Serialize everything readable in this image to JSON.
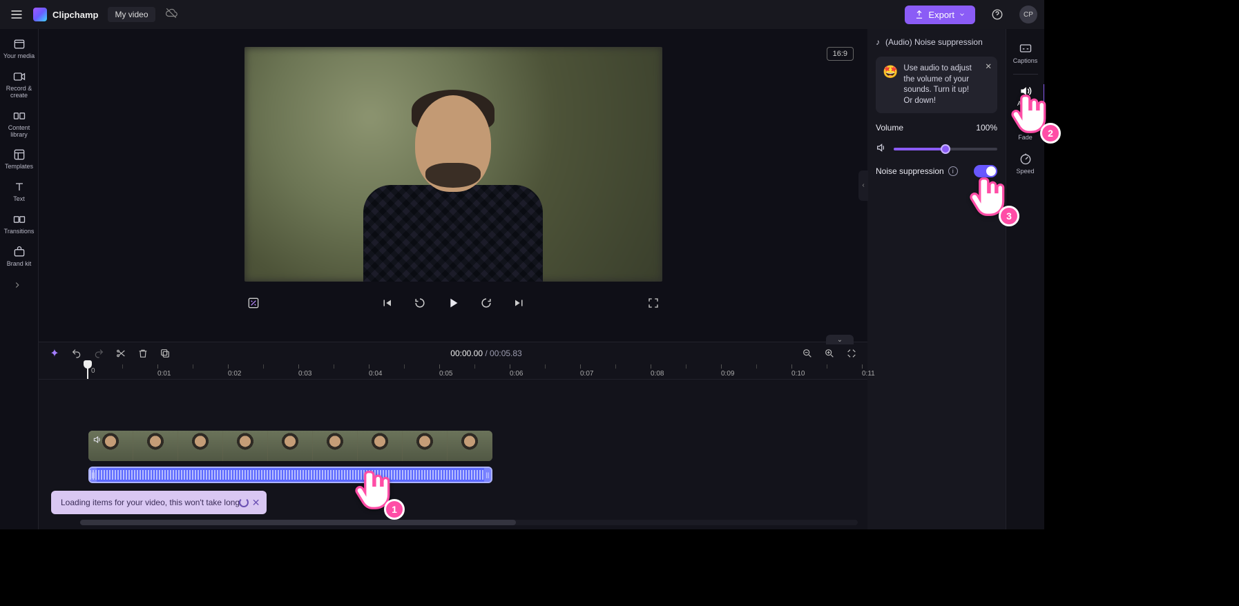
{
  "header": {
    "brand": "Clipchamp",
    "project_title": "My video",
    "export_label": "Export",
    "avatar_initials": "CP",
    "aspect_ratio": "16:9"
  },
  "left_sidebar": {
    "items": [
      {
        "label": "Your media"
      },
      {
        "label": "Record & create"
      },
      {
        "label": "Content library"
      },
      {
        "label": "Templates"
      },
      {
        "label": "Text"
      },
      {
        "label": "Transitions"
      },
      {
        "label": "Brand kit"
      }
    ]
  },
  "right_sidebar": {
    "items": [
      {
        "label": "Captions"
      },
      {
        "label": "Audio"
      },
      {
        "label": "Fade"
      },
      {
        "label": "Speed"
      }
    ]
  },
  "props": {
    "head": "(Audio) Noise suppression",
    "tip": "Use audio to adjust the volume of your sounds. Turn it up! Or down!",
    "emoji": "🤩",
    "volume_label": "Volume",
    "volume_value": "100%",
    "noise_suppression_label": "Noise suppression"
  },
  "timeline": {
    "current": "00:00.00",
    "separator": " / ",
    "duration": "00:05.83",
    "ticks": [
      "0",
      "0:01",
      "0:02",
      "0:03",
      "0:04",
      "0:05",
      "0:06",
      "0:07",
      "0:08",
      "0:09",
      "0:10",
      "0:11"
    ]
  },
  "toast": {
    "text": "Loading items for your video, this won't take long."
  },
  "pointers": {
    "p1": "1",
    "p2": "2",
    "p3": "3"
  }
}
